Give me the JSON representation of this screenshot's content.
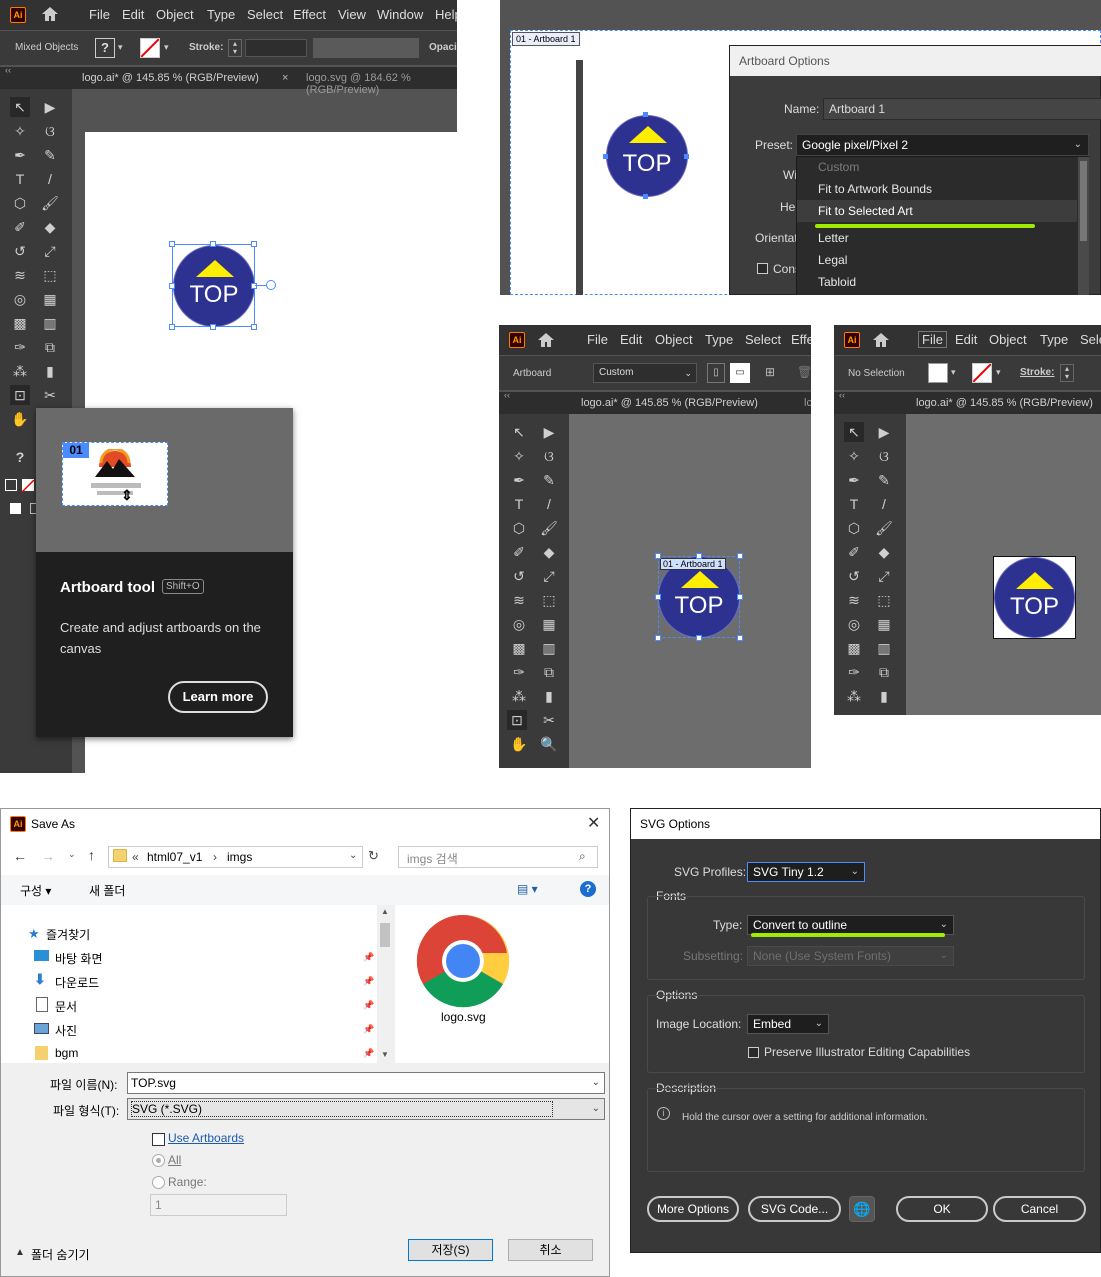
{
  "panel1": {
    "menu": [
      "File",
      "Edit",
      "Object",
      "Type",
      "Select",
      "Effect",
      "View",
      "Window",
      "Help"
    ],
    "control_label": "Mixed Objects",
    "stroke_label": "Stroke:",
    "opacity_label": "Opacit",
    "tabs": [
      "logo.ai* @ 145.85 % (RGB/Preview)",
      "logo.svg @ 184.62 % (RGB/Preview)"
    ],
    "logo_text": "TOP",
    "tooltip": {
      "artboard_badge": "01",
      "title": "Artboard tool",
      "shortcut": "Shift+O",
      "description": "Create and adjust artboards on the canvas",
      "learn_more": "Learn more"
    }
  },
  "panel2": {
    "artboard_label": "01 - Artboard 1",
    "logo_text": "TOP",
    "dialog_title": "Artboard Options",
    "name_label": "Name:",
    "name_value": "Artboard 1",
    "preset_label": "Preset:",
    "preset_value": "Google pixel/Pixel 2",
    "partial_labels": [
      "Wi",
      "Hei",
      "Orientat",
      "Cons"
    ],
    "dropdown_items": [
      "Custom",
      "Fit to Artwork Bounds",
      "Fit to Selected Art",
      "Letter",
      "Legal",
      "Tabloid"
    ],
    "highlight_color": "#aaff00"
  },
  "panel3": {
    "menu": [
      "File",
      "Edit",
      "Object",
      "Type",
      "Select",
      "Effe"
    ],
    "control_label": "Artboard",
    "preset_value": "Custom",
    "tabs": [
      "logo.ai* @ 145.85 % (RGB/Preview)",
      "lc"
    ],
    "artboard_label": "01 - Artboard 1",
    "logo_text": "TOP"
  },
  "panel4": {
    "menu": [
      "File",
      "Edit",
      "Object",
      "Type",
      "Sele"
    ],
    "control_label": "No Selection",
    "stroke_label": "Stroke:",
    "tabs": [
      "logo.ai* @ 145.85 % (RGB/Preview)"
    ],
    "logo_text": "TOP"
  },
  "save_as": {
    "title": "Save As",
    "breadcrumb": [
      "«",
      "html07_v1",
      "›",
      "imgs"
    ],
    "search_placeholder": "imgs 검색",
    "organize": "구성 ▾",
    "new_folder": "새 폴더",
    "tree": [
      "즐겨찾기",
      "바탕 화면",
      "다운로드",
      "문서",
      "사진",
      "bgm"
    ],
    "file_icon_label": "logo.svg",
    "filename_label": "파일 이름(N):",
    "filename_value": "TOP.svg",
    "filetype_label": "파일 형식(T):",
    "filetype_value": "SVG (*.SVG)",
    "use_artboards": "Use Artboards",
    "all": "All",
    "range": "Range:",
    "range_value": "1",
    "hide_folders": "폴더 숨기기",
    "save": "저장(S)",
    "cancel": "취소"
  },
  "svg_options": {
    "title": "SVG Options",
    "profiles_label": "SVG Profiles:",
    "profiles_value": "SVG Tiny 1.2",
    "fonts_section": "Fonts",
    "type_label": "Type:",
    "type_value": "Convert to outline",
    "subsetting_label": "Subsetting:",
    "subsetting_value": "None (Use System Fonts)",
    "options_section": "Options",
    "image_location_label": "Image Location:",
    "image_location_value": "Embed",
    "preserve_label": "Preserve Illustrator Editing Capabilities",
    "description_section": "Description",
    "description_text": "Hold the cursor over a setting for additional information.",
    "more_options": "More Options",
    "svg_code": "SVG Code...",
    "ok": "OK",
    "cancel": "Cancel",
    "highlight_color": "#aaff00"
  }
}
